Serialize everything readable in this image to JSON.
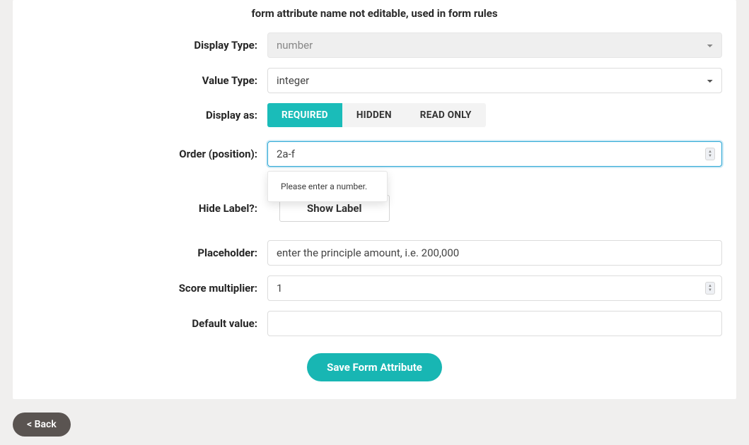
{
  "helper_text": "form attribute name not editable, used in form rules",
  "labels": {
    "display_type": "Display Type:",
    "value_type": "Value Type:",
    "display_as": "Display as:",
    "order": "Order (position):",
    "hide_label": "Hide Label?:",
    "placeholder": "Placeholder:",
    "score_multiplier": "Score multiplier:",
    "default_value": "Default value:"
  },
  "display_type": {
    "value": "number"
  },
  "value_type": {
    "value": "integer"
  },
  "display_as": {
    "options": {
      "required": "REQUIRED",
      "hidden": "HIDDEN",
      "read_only": "READ ONLY"
    }
  },
  "order": {
    "value": "2a-f",
    "tooltip": "Please enter a number."
  },
  "hide_label": {
    "button": "Show Label"
  },
  "placeholder_field": {
    "value": "enter the principle amount, i.e. 200,000"
  },
  "score_multiplier": {
    "value": "1"
  },
  "default_value": {
    "value": ""
  },
  "buttons": {
    "save": "Save Form Attribute",
    "back": "< Back"
  }
}
